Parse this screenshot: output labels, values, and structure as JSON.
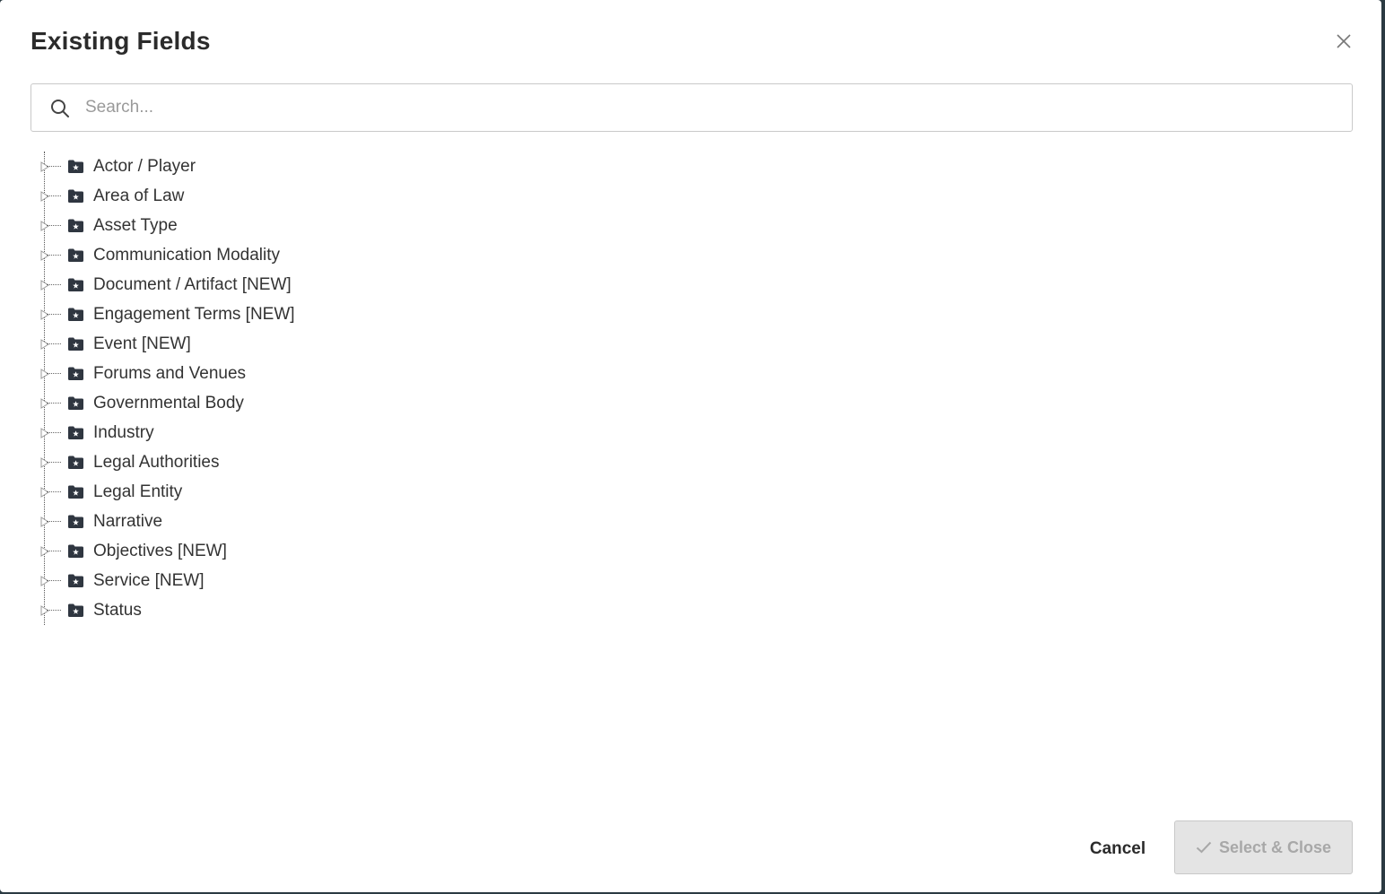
{
  "dialog": {
    "title": "Existing Fields",
    "close_icon": "close-icon"
  },
  "search": {
    "placeholder": "Search...",
    "value": "",
    "icon": "search-icon"
  },
  "tree": {
    "item_icon": "folder-star-icon",
    "toggle_icon": "caret-right-icon",
    "items": [
      {
        "label": "Actor / Player"
      },
      {
        "label": "Area of Law"
      },
      {
        "label": "Asset Type"
      },
      {
        "label": "Communication Modality"
      },
      {
        "label": "Document / Artifact [NEW]"
      },
      {
        "label": "Engagement Terms [NEW]"
      },
      {
        "label": "Event [NEW]"
      },
      {
        "label": "Forums and Venues"
      },
      {
        "label": "Governmental Body"
      },
      {
        "label": "Industry"
      },
      {
        "label": "Legal Authorities"
      },
      {
        "label": "Legal Entity"
      },
      {
        "label": "Narrative"
      },
      {
        "label": "Objectives [NEW]"
      },
      {
        "label": "Service [NEW]"
      },
      {
        "label": "Status"
      }
    ]
  },
  "footer": {
    "cancel_label": "Cancel",
    "select_close_label": "Select & Close",
    "select_close_icon": "check-icon",
    "select_close_disabled": true
  },
  "colors": {
    "title_text": "#2b2b2b",
    "folder_icon": "#2f3640",
    "disabled_button_bg": "#e4e4e4",
    "disabled_button_text": "#a8a8a8"
  }
}
